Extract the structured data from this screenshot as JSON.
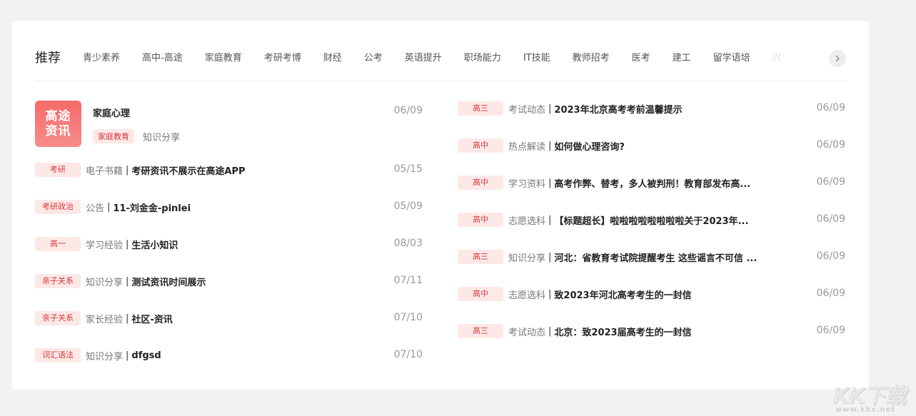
{
  "tabs": {
    "items": [
      "推荐",
      "青少素养",
      "高中-高途",
      "家庭教育",
      "考研考博",
      "财经",
      "公考",
      "英语提升",
      "职场能力",
      "IT技能",
      "教师招考",
      "医考",
      "建工",
      "留学语培",
      "兴"
    ],
    "active_index": 0
  },
  "icons": {
    "next": "chevron-right-icon"
  },
  "featured": {
    "thumb_text": "高途资讯",
    "title": "家庭心理",
    "tag": "家庭教育",
    "tag2": "知识分享",
    "date": "06/09"
  },
  "left_list": [
    {
      "badge": "考研",
      "category": "电子书籍",
      "title": "考研资讯不展示在高途APP",
      "date": "05/15"
    },
    {
      "badge": "考研政治",
      "category": "公告",
      "title": "11-刘金金-pinlei",
      "date": "05/09"
    },
    {
      "badge": "高一",
      "category": "学习经验",
      "title": "生活小知识",
      "date": "08/03"
    },
    {
      "badge": "亲子关系",
      "category": "知识分享",
      "title": "测试资讯时间展示",
      "date": "07/11"
    },
    {
      "badge": "亲子关系",
      "category": "家长经验",
      "title": "社区-资讯",
      "date": "07/10"
    },
    {
      "badge": "词汇语法",
      "category": "知识分享",
      "title": "dfgsd",
      "date": "07/10"
    }
  ],
  "right_list": [
    {
      "badge": "高三",
      "category": "考试动态",
      "title": "2023年北京高考考前温馨提示",
      "date": "06/09"
    },
    {
      "badge": "高中",
      "category": "热点解读",
      "title": "如何做心理咨询?",
      "date": "06/09"
    },
    {
      "badge": "高中",
      "category": "学习资料",
      "title": "高考作弊、替考，多人被判刑！教育部发布高...",
      "date": "06/09"
    },
    {
      "badge": "高中",
      "category": "志愿选科",
      "title": "【标题超长】啦啦啦啦啦啦啦啦关于2023年...",
      "date": "06/09"
    },
    {
      "badge": "高三",
      "category": "知识分享",
      "title": "河北：省教育考试院提醒考生 这些谣言不可信 ...",
      "date": "06/09"
    },
    {
      "badge": "高中",
      "category": "志愿选科",
      "title": "致2023年河北高考考生的一封信",
      "date": "06/09"
    },
    {
      "badge": "高三",
      "category": "考试动态",
      "title": "北京：致2023届高考生的一封信",
      "date": "06/09"
    }
  ],
  "separator": "|",
  "watermark": {
    "logo": "KK下载",
    "url": "www.kkx.net"
  },
  "colors": {
    "accent": "#e2312c",
    "badge_bg": "#fde8e8",
    "badge_text": "#d8393a"
  }
}
